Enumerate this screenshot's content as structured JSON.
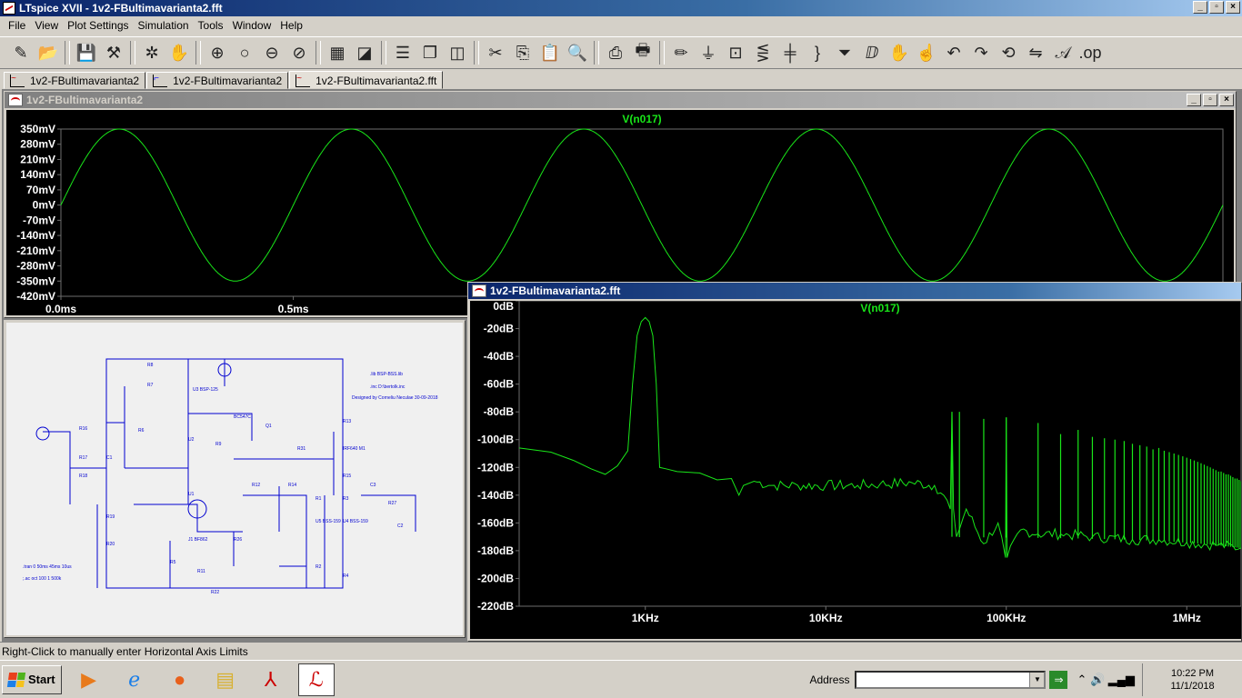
{
  "app": {
    "title": "LTspice XVII - 1v2-FBultimavarianta2.fft"
  },
  "window_controls": [
    "_",
    "▫",
    "×"
  ],
  "menu": [
    {
      "label": "File",
      "key": "F"
    },
    {
      "label": "View",
      "key": "V"
    },
    {
      "label": "Plot Settings",
      "key": "P"
    },
    {
      "label": "Simulation",
      "key": "S"
    },
    {
      "label": "Tools",
      "key": "T"
    },
    {
      "label": "Window",
      "key": "W"
    },
    {
      "label": "Help",
      "key": "H"
    }
  ],
  "toolbar_icons": [
    "new-schematic-icon",
    "open-icon",
    "save-icon",
    "control-panel-icon",
    "run-icon",
    "pause-icon",
    "zoom-in-icon",
    "zoom-full-icon",
    "zoom-out-icon",
    "zoom-cancel-icon",
    "autorange-icon",
    "fft-icon",
    "tile-horizontal-icon",
    "cascade-icon",
    "tile-vertical-icon",
    "cut-icon",
    "copy-icon",
    "paste-icon",
    "find-icon",
    "print-setup-icon",
    "print-icon",
    "wire-icon",
    "ground-icon",
    "label-icon",
    "resistor-icon",
    "capacitor-icon",
    "inductor-icon",
    "diode-icon",
    "component-icon",
    "move-icon",
    "drag-icon",
    "undo-icon",
    "redo-icon",
    "rotate-icon",
    "mirror-icon",
    "text-icon",
    "spice-directive-icon"
  ],
  "tabs": [
    {
      "label": "1v2-FBultimavarianta2",
      "kind": "waveform"
    },
    {
      "label": "1v2-FBultimavarianta2",
      "kind": "schematic"
    },
    {
      "label": "1v2-FBultimavarianta2.fft",
      "kind": "fft"
    }
  ],
  "time_window": {
    "title": "1v2-FBultimavarianta2",
    "trace": "V(n017)",
    "y_ticks": [
      "350mV",
      "280mV",
      "210mV",
      "140mV",
      "70mV",
      "0mV",
      "-70mV",
      "-140mV",
      "-210mV",
      "-280mV",
      "-350mV",
      "-420mV"
    ],
    "x_ticks": [
      "0.0ms",
      "0.5ms",
      "1.0ms",
      "1.5ms"
    ]
  },
  "fft_window": {
    "title": "1v2-FBultimavarianta2.fft",
    "trace": "V(n017)",
    "y_ticks": [
      "0dB",
      "-20dB",
      "-40dB",
      "-60dB",
      "-80dB",
      "-100dB",
      "-120dB",
      "-140dB",
      "-160dB",
      "-180dB",
      "-200dB",
      "-220dB"
    ],
    "x_ticks": [
      "1KHz",
      "10KHz",
      "100KHz",
      "1MHz"
    ]
  },
  "schematic": {
    "texts": [
      ".lib BSP-BSS.lib",
      ".inc D:\\bertolk.inc",
      "Designed by Corneliu Neculae 30-09-2018",
      ".tran 0 50ms 45ms 10us",
      ";.ac oct 100 1 500k"
    ]
  },
  "colors": {
    "trace": "#19e619",
    "plot_bg": "#000000",
    "grid": "#6e6e6e"
  },
  "status": {
    "text": "Right-Click to manually enter Horizontal Axis Limits"
  },
  "taskbar": {
    "start_label": "Start",
    "address_label": "Address",
    "address_value": "",
    "clock_time": "10:22 PM",
    "clock_date": "11/1/2018",
    "apps": [
      "media-player-icon",
      "ie-icon",
      "firefox-icon",
      "explorer-icon",
      "acrobat-icon",
      "ltspice-icon"
    ]
  },
  "chart_data": [
    {
      "type": "line",
      "title": "V(n017)",
      "xlabel": "",
      "ylabel": "",
      "x_unit": "ms",
      "y_unit": "mV",
      "xlim": [
        0,
        2.5
      ],
      "ylim": [
        -420,
        350
      ],
      "grid": true,
      "series": [
        {
          "name": "V(n017)",
          "shape": "sine",
          "amplitude_mV": 350,
          "offset_mV": 0,
          "frequency_Hz": 2000,
          "phase_deg": 0
        }
      ]
    },
    {
      "type": "line",
      "title": "V(n017)",
      "xlabel": "",
      "ylabel": "",
      "x_scale": "log",
      "x_unit": "Hz",
      "y_unit": "dB",
      "xlim": [
        200,
        2000000
      ],
      "ylim": [
        -220,
        0
      ],
      "grid": true,
      "series": [
        {
          "name": "V(n017)",
          "x": [
            200,
            300,
            400,
            500,
            600,
            700,
            800,
            850,
            900,
            950,
            1000,
            1050,
            1100,
            1150,
            1200,
            1300,
            1500,
            2000,
            2500,
            3000,
            3300,
            3500,
            4000,
            5000,
            7000,
            10000,
            15000,
            20000,
            30000,
            40000,
            45000,
            49000,
            50000,
            51000,
            53000,
            60000,
            75000,
            90000,
            99000,
            100000,
            101000,
            120000,
            150000,
            200000,
            300000,
            500000,
            700000,
            1000000,
            1500000,
            2000000
          ],
          "y": [
            -106,
            -109,
            -115,
            -121,
            -125,
            -119,
            -108,
            -60,
            -25,
            -15,
            -12,
            -15,
            -25,
            -60,
            -120,
            -121,
            -123,
            -124,
            -129,
            -128,
            -140,
            -133,
            -130,
            -133,
            -133,
            -133,
            -133,
            -132,
            -131,
            -133,
            -140,
            -150,
            -80,
            -150,
            -170,
            -150,
            -175,
            -160,
            -185,
            -84,
            -185,
            -165,
            -168,
            -168,
            -170,
            -172,
            -172,
            -174,
            -176,
            -178
          ]
        },
        {
          "name": "harmonic peaks",
          "x": [
            50000,
            55000,
            75000,
            100000,
            150000,
            200000,
            250000,
            300000,
            350000,
            400000,
            450000,
            500000,
            550000,
            600000,
            650000,
            700000,
            750000,
            800000,
            850000,
            900000,
            950000,
            1000000,
            1050000,
            1100000,
            1150000,
            1200000,
            1250000,
            1300000,
            1350000,
            1400000,
            1450000,
            1500000,
            1550000,
            1600000,
            1650000,
            1700000,
            1750000,
            1800000,
            1850000,
            1900000,
            1950000,
            2000000
          ],
          "y": [
            -80,
            -80,
            -85,
            -84,
            -88,
            -96,
            -93,
            -98,
            -99,
            -100,
            -101,
            -103,
            -104,
            -105,
            -107,
            -106,
            -108,
            -109,
            -110,
            -111,
            -112,
            -113,
            -114,
            -115,
            -116,
            -117,
            -118,
            -119,
            -120,
            -121,
            -122,
            -123,
            -123,
            -124,
            -125,
            -125,
            -126,
            -127,
            -128,
            -128,
            -129,
            -130
          ]
        }
      ]
    }
  ]
}
